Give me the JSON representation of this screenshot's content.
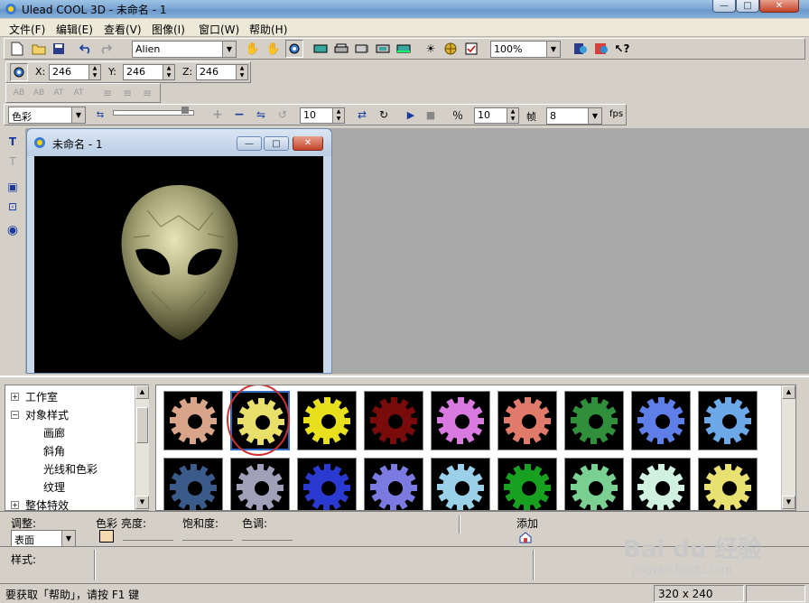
{
  "window": {
    "title": "Ulead COOL 3D - 未命名 - 1",
    "minimize": "—",
    "maximize": "□",
    "close": "✕"
  },
  "menu": [
    "文件(F)",
    "编辑(E)",
    "查看(V)",
    "图像(I)",
    "窗口(W)",
    "帮助(H)"
  ],
  "toolbar1": {
    "font_value": "Alien",
    "zoom_value": "100%"
  },
  "toolbar2": {
    "x_label": "X:",
    "x_value": "246",
    "y_label": "Y:",
    "y_value": "246",
    "z_label": "Z:",
    "z_value": "246"
  },
  "toolbar3": {
    "text_buttons": [
      "AB",
      "AB",
      "AT",
      "AT"
    ]
  },
  "toolbar4": {
    "attr_combo": "色彩",
    "frame_value": "10",
    "frame_count": "10",
    "frame_label": "帧",
    "fps_value": "8",
    "fps_label": "fps"
  },
  "document": {
    "title": "未命名 - 1"
  },
  "library": {
    "tree": [
      {
        "label": "工作室",
        "expander": "+"
      },
      {
        "label": "对象样式",
        "expander": "−"
      },
      {
        "label": "画廊",
        "expander": ""
      },
      {
        "label": "斜角",
        "expander": ""
      },
      {
        "label": "光线和色彩",
        "expander": ""
      },
      {
        "label": "纹理",
        "expander": ""
      },
      {
        "label": "整体特效",
        "expander": "+"
      }
    ],
    "thumb_colors_row1": [
      "#d9a58a",
      "#e8e06a",
      "#e8e01c",
      "#7a0b0b",
      "#d87ae0",
      "#e07a6a",
      "#2f8f3a",
      "#5e7ee8",
      "#6da8e8"
    ],
    "thumb_colors_row2": [
      "#3a5a8a",
      "#a0a0b8",
      "#2a3ad0",
      "#7a7ae0",
      "#9ad0e8",
      "#18a020",
      "#7ad090",
      "#d0f0e0",
      "#e8e070"
    ],
    "selected_index": 1
  },
  "attributes": {
    "adjust_label": "调整:",
    "adjust_value": "表面",
    "color_label": "色彩",
    "brightness_label": "亮度:",
    "saturation_label": "饱和度:",
    "hue_label": "色调:",
    "add_label": "添加",
    "style_label": "样式:"
  },
  "status": {
    "help_text": "要获取「帮助」，请按 F1 键",
    "dimensions": "320 x 240"
  },
  "watermark": {
    "brand": "Bai du 经验",
    "url": "jingyan.baidu.com"
  }
}
